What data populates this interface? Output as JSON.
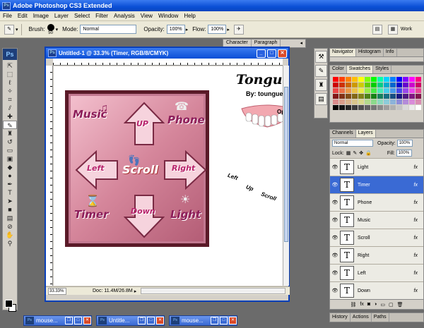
{
  "app": {
    "title": "Adobe Photoshop CS3 Extended",
    "icon_label": "Ps"
  },
  "menu": [
    "File",
    "Edit",
    "Image",
    "Layer",
    "Select",
    "Filter",
    "Analysis",
    "View",
    "Window",
    "Help"
  ],
  "options": {
    "brush_label": "Brush:",
    "brush_size": "50",
    "mode_label": "Mode:",
    "mode_value": "Normal",
    "opacity_label": "Opacity:",
    "opacity_value": "100%",
    "flow_label": "Flow:",
    "flow_value": "100%",
    "workspace_label": "Work"
  },
  "floating_tabs": [
    "Character",
    "Paragraph"
  ],
  "tools": {
    "badge": "Ps"
  },
  "document": {
    "title": "Untitled-1 @ 33.3% (Timer, RGB/8/CMYK)",
    "zoom": "33.33%",
    "doc_info": "Doc: 11.4M/26.8M",
    "pad_labels": {
      "up": "UP",
      "down": "Down",
      "left": "Left",
      "right": "Right",
      "music": "Music",
      "phone": "Phone",
      "timer": "Timer",
      "light": "Light",
      "scroll": "Scroll"
    },
    "tongue": {
      "title": "Tongue T",
      "byline": "By: toungue",
      "opt": "Opt",
      "left": "Left",
      "up": "Up",
      "scroll": "Scroll"
    }
  },
  "panels": {
    "navigator_tabs": [
      "Navigator",
      "Histogram",
      "Info"
    ],
    "color_tabs": [
      "Color",
      "Swatches",
      "Styles"
    ],
    "layers_tabs": [
      "Channels",
      "Layers"
    ],
    "layers": {
      "blend_mode": "Normal",
      "opacity_label": "Opacity:",
      "opacity_value": "100%",
      "lock_label": "Lock:",
      "fill_label": "Fill:",
      "fill_value": "100%",
      "items": [
        {
          "name": "Light",
          "selected": false
        },
        {
          "name": "Timer",
          "selected": true
        },
        {
          "name": "Phone",
          "selected": false
        },
        {
          "name": "Music",
          "selected": false
        },
        {
          "name": "Scroll",
          "selected": false
        },
        {
          "name": "Right",
          "selected": false
        },
        {
          "name": "Left",
          "selected": false
        },
        {
          "name": "Down",
          "selected": false
        }
      ],
      "fx_label": "fx"
    },
    "history_tabs": [
      "History",
      "Actions",
      "Paths"
    ]
  },
  "minimized_docs": [
    "mouse...",
    "Untitle...",
    "mouse..."
  ],
  "colors": {
    "titlebar": "#0a4fd6",
    "layer_selected": "#3a6ad4",
    "pad_border": "#5a1a28",
    "pad_label": "#b8236c"
  }
}
